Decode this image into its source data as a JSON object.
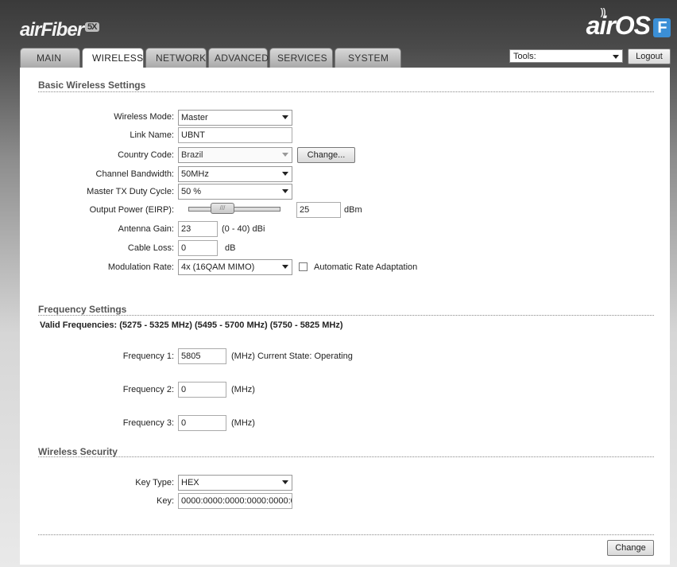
{
  "brand": {
    "left_name": "airFiber",
    "left_badge": "5X",
    "right_name": "airOS",
    "right_badge": "F"
  },
  "tabs": [
    "MAIN",
    "WIRELESS",
    "NETWORK",
    "ADVANCED",
    "SERVICES",
    "SYSTEM"
  ],
  "toolbar": {
    "tools_value": "Tools:",
    "logout_label": "Logout"
  },
  "basic": {
    "title": "Basic Wireless Settings",
    "wireless_mode_label": "Wireless Mode:",
    "wireless_mode_value": "Master",
    "link_name_label": "Link Name:",
    "link_name_value": "UBNT",
    "country_code_label": "Country Code:",
    "country_code_value": "Brazil",
    "change_label": "Change...",
    "channel_bw_label": "Channel Bandwidth:",
    "channel_bw_value": "50MHz",
    "duty_cycle_label": "Master TX Duty Cycle:",
    "duty_cycle_value": "50 %",
    "output_power_label": "Output Power (EIRP):",
    "output_power_value": "25",
    "output_power_unit": "dBm",
    "antenna_gain_label": "Antenna Gain:",
    "antenna_gain_value": "23",
    "antenna_gain_range": "(0 - 40) dBi",
    "cable_loss_label": "Cable Loss:",
    "cable_loss_value": "0",
    "cable_loss_unit": "dB",
    "modulation_label": "Modulation Rate:",
    "modulation_value": "4x (16QAM MIMO)",
    "auto_rate_label": "Automatic Rate Adaptation"
  },
  "frequency": {
    "title": "Frequency Settings",
    "valid": "Valid Frequencies: (5275 - 5325 MHz) (5495 - 5700 MHz) (5750 - 5825 MHz)",
    "f1_label": "Frequency 1:",
    "f1_value": "5805",
    "f1_note": "(MHz) Current State: Operating",
    "f2_label": "Frequency 2:",
    "f2_value": "0",
    "f2_note": "(MHz)",
    "f3_label": "Frequency 3:",
    "f3_value": "0",
    "f3_note": "(MHz)"
  },
  "security": {
    "title": "Wireless Security",
    "key_type_label": "Key Type:",
    "key_type_value": "HEX",
    "key_label": "Key:",
    "key_value": "0000:0000:0000:0000:0000:0"
  },
  "footer": {
    "change_label": "Change"
  }
}
